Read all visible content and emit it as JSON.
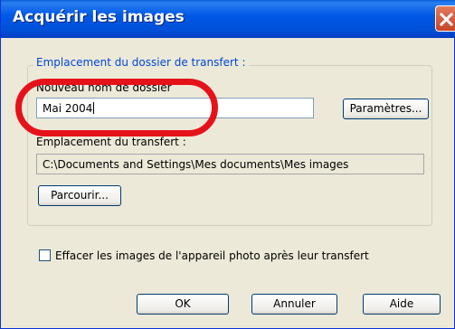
{
  "dialog": {
    "title": "Acquérir les images",
    "group_title": "Emplacement du dossier de transfert :",
    "folder_name_label": "Nouveau nom de dossier",
    "folder_name_value": "Mai 2004",
    "settings_button": "Paramètres...",
    "transfer_location_label": "Emplacement du transfert :",
    "transfer_location_value": "C:\\Documents and Settings\\Mes documents\\Mes images",
    "browse_button": "Parcourir...",
    "delete_checkbox_label": "Effacer les images de l'appareil photo après leur transfert",
    "delete_checkbox_checked": false,
    "ok_button": "OK",
    "cancel_button": "Annuler",
    "help_button": "Aide"
  },
  "colors": {
    "titlebar": "#0058e6",
    "group_title": "#0046d5",
    "highlight": "#e5121a"
  },
  "icons": {
    "close": "close-icon"
  }
}
